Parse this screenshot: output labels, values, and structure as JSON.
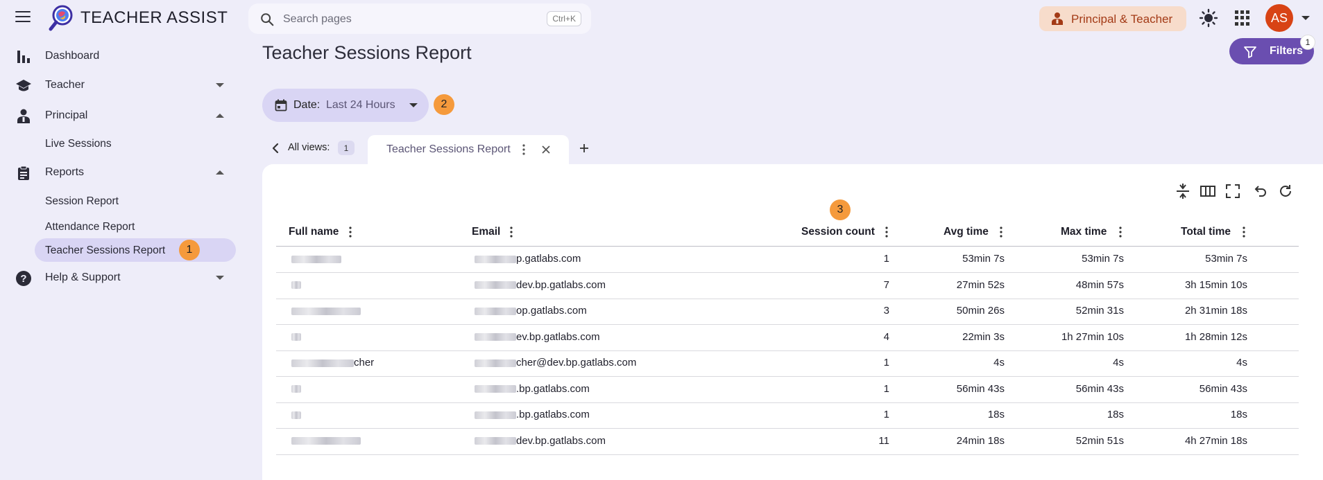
{
  "header": {
    "app_title": "TEACHER ASSIST",
    "search_placeholder": "Search pages",
    "search_shortcut": "Ctrl+K",
    "role_label": "Principal & Teacher",
    "avatar_initials": "AS"
  },
  "sidebar": {
    "items": [
      {
        "label": "Dashboard",
        "icon": "bar-chart-icon"
      },
      {
        "label": "Teacher",
        "icon": "graduation-cap-icon",
        "expanded": false
      },
      {
        "label": "Principal",
        "icon": "person-icon",
        "expanded": true,
        "children": [
          "Live Sessions"
        ]
      },
      {
        "label": "Reports",
        "icon": "clipboard-icon",
        "expanded": true,
        "children": [
          "Session Report",
          "Attendance Report",
          "Teacher Sessions Report"
        ]
      },
      {
        "label": "Help & Support",
        "icon": "help-icon",
        "expanded": false
      }
    ],
    "active_badge": "1"
  },
  "main": {
    "page_title": "Teacher Sessions Report",
    "filters_label": "Filters",
    "filters_count": "1",
    "date_label": "Date:",
    "date_value": "Last 24 Hours",
    "date_badge": "2",
    "views_label": "All views:",
    "views_count": "1",
    "tab_label": "Teacher Sessions Report",
    "column_badge": "3"
  },
  "table": {
    "columns": [
      "Full name",
      "Email",
      "Session count",
      "Avg time",
      "Max time",
      "Total time"
    ],
    "rows": [
      {
        "name": "",
        "email": "p.gatlabs.com",
        "count": "1",
        "avg": "53min 7s",
        "max": "53min 7s",
        "total": "53min 7s"
      },
      {
        "name": "",
        "email": "dev.bp.gatlabs.com",
        "count": "7",
        "avg": "27min 52s",
        "max": "48min 57s",
        "total": "3h 15min 10s"
      },
      {
        "name": "",
        "email": "op.gatlabs.com",
        "count": "3",
        "avg": "50min 26s",
        "max": "52min 31s",
        "total": "2h 31min 18s"
      },
      {
        "name": "",
        "email": "ev.bp.gatlabs.com",
        "count": "4",
        "avg": "22min 3s",
        "max": "1h 27min 10s",
        "total": "1h 28min 12s"
      },
      {
        "name": "cher",
        "email": "cher@dev.bp.gatlabs.com",
        "count": "1",
        "avg": "4s",
        "max": "4s",
        "total": "4s"
      },
      {
        "name": "",
        "email": ".bp.gatlabs.com",
        "count": "1",
        "avg": "56min 43s",
        "max": "56min 43s",
        "total": "56min 43s"
      },
      {
        "name": "",
        "email": ".bp.gatlabs.com",
        "count": "1",
        "avg": "18s",
        "max": "18s",
        "total": "18s"
      },
      {
        "name": "",
        "email": "dev.bp.gatlabs.com",
        "count": "11",
        "avg": "24min 18s",
        "max": "52min 51s",
        "total": "4h 27min 18s"
      }
    ]
  },
  "colors": {
    "accent": "#6a4eb0",
    "badge": "#f59a3c",
    "avatar": "#d84315",
    "role_chip_bg": "#f7dccb",
    "active_nav_bg": "#d9d5f4"
  }
}
